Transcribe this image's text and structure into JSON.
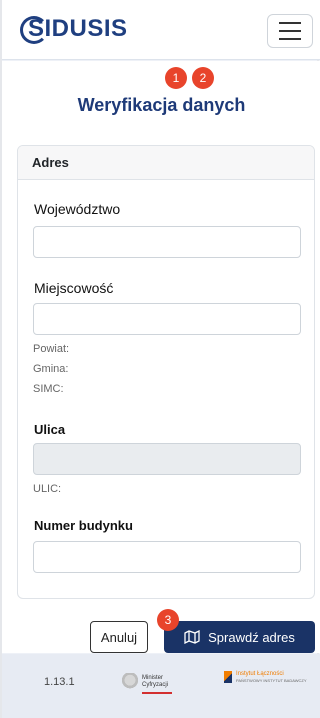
{
  "brand": {
    "logo_text": "SIDUSIS"
  },
  "navbar": {
    "menu_icon": "hamburger-menu-icon"
  },
  "steps": [
    "1",
    "2",
    "3"
  ],
  "page": {
    "title": "Weryfikacja danych"
  },
  "card": {
    "header": "Adres",
    "wojewodztwo_label": "Województwo",
    "miejscowosc_label": "Miejscowość",
    "powiat_label": "Powiat:",
    "gmina_label": "Gmina:",
    "simc_label": "SIMC:",
    "ulica_label": "Ulica",
    "ulic_label": "ULIC:",
    "numer_label": "Numer budynku"
  },
  "actions": {
    "cancel_label": "Anuluj",
    "check_label": "Sprawdź adres",
    "check_icon": "map-icon"
  },
  "footer": {
    "version": "1.13.1",
    "ministry_line1": "Minister",
    "ministry_line2": "Cyfryzacji",
    "il_name": "Instytut Łączności",
    "il_sub": "PAŃSTWOWY INSTYTUT BADAWCZY"
  },
  "colors": {
    "primary": "#1a3366",
    "step": "#e8442b",
    "title": "#1e3a78"
  }
}
